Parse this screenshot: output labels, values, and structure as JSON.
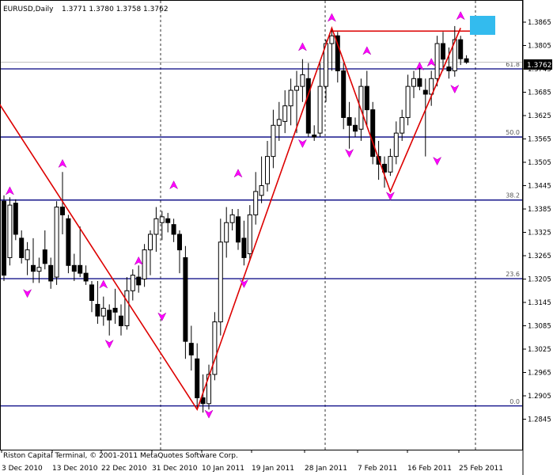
{
  "header": {
    "symbol": "EURUSD,Daily",
    "ohlc": "1.3771 1.3780 1.3758 1.3762"
  },
  "footer": {
    "copyright": "Riston Capital Terminal, © 2001-2011 MetaQuotes Software Corp."
  },
  "colors": {
    "background": "#ffffff",
    "axis": "#000000",
    "grid_vertical": "#000000",
    "fib_lines": "#000080",
    "zigzag": "#dd0000",
    "arrows": "#ff00ff",
    "highlight_box": "#33bbee",
    "price_tag_bg": "#000000",
    "price_tag_fg": "#ffffff"
  },
  "chart_data": {
    "type": "candlestick",
    "price_axis_labels": [
      "1.3865",
      "1.3805",
      "1.3745",
      "1.3685",
      "1.3625",
      "1.3565",
      "1.3505",
      "1.3445",
      "1.3385",
      "1.3325",
      "1.3265",
      "1.3205",
      "1.3145",
      "1.3085",
      "1.3025",
      "1.2965",
      "1.2905",
      "1.2845"
    ],
    "current_price": "1.3762",
    "date_labels": [
      "3 Dec 2010",
      "13 Dec 2010",
      "22 Dec 2010",
      "31 Dec 2010",
      "10 Jan 2011",
      "19 Jan 2011",
      "28 Jan 2011",
      "7 Feb 2011",
      "16 Feb 2011",
      "25 Feb 2011"
    ],
    "fibonacci_levels": [
      {
        "label": "61.8",
        "price": 1.3745
      },
      {
        "label": "50.0",
        "price": 1.357
      },
      {
        "label": "38.2",
        "price": 1.3408
      },
      {
        "label": "23.6",
        "price": 1.3206
      },
      {
        "label": "0.0",
        "price": 1.2879
      }
    ],
    "top_line_price": 1.3842,
    "ohlc_bars": [
      {
        "o": 1.3405,
        "h": 1.342,
        "l": 1.32,
        "c": 1.3215
      },
      {
        "o": 1.326,
        "h": 1.3415,
        "l": 1.324,
        "c": 1.3395
      },
      {
        "o": 1.34,
        "h": 1.341,
        "l": 1.3305,
        "c": 1.332
      },
      {
        "o": 1.331,
        "h": 1.333,
        "l": 1.3245,
        "c": 1.326
      },
      {
        "o": 1.3255,
        "h": 1.33,
        "l": 1.3215,
        "c": 1.328
      },
      {
        "o": 1.324,
        "h": 1.331,
        "l": 1.3195,
        "c": 1.3225
      },
      {
        "o": 1.3225,
        "h": 1.326,
        "l": 1.3195,
        "c": 1.3235
      },
      {
        "o": 1.328,
        "h": 1.333,
        "l": 1.323,
        "c": 1.3245
      },
      {
        "o": 1.324,
        "h": 1.326,
        "l": 1.318,
        "c": 1.32
      },
      {
        "o": 1.321,
        "h": 1.3405,
        "l": 1.319,
        "c": 1.339
      },
      {
        "o": 1.339,
        "h": 1.348,
        "l": 1.332,
        "c": 1.337
      },
      {
        "o": 1.336,
        "h": 1.337,
        "l": 1.322,
        "c": 1.324
      },
      {
        "o": 1.324,
        "h": 1.327,
        "l": 1.32,
        "c": 1.3225
      },
      {
        "o": 1.324,
        "h": 1.334,
        "l": 1.321,
        "c": 1.322
      },
      {
        "o": 1.322,
        "h": 1.324,
        "l": 1.319,
        "c": 1.32
      },
      {
        "o": 1.319,
        "h": 1.32,
        "l": 1.312,
        "c": 1.315
      },
      {
        "o": 1.314,
        "h": 1.32,
        "l": 1.309,
        "c": 1.311
      },
      {
        "o": 1.311,
        "h": 1.316,
        "l": 1.3085,
        "c": 1.313
      },
      {
        "o": 1.3125,
        "h": 1.314,
        "l": 1.306,
        "c": 1.31
      },
      {
        "o": 1.313,
        "h": 1.318,
        "l": 1.309,
        "c": 1.312
      },
      {
        "o": 1.311,
        "h": 1.314,
        "l": 1.306,
        "c": 1.3085
      },
      {
        "o": 1.3085,
        "h": 1.321,
        "l": 1.3075,
        "c": 1.3175
      },
      {
        "o": 1.3175,
        "h": 1.323,
        "l": 1.315,
        "c": 1.3215
      },
      {
        "o": 1.321,
        "h": 1.324,
        "l": 1.317,
        "c": 1.319
      },
      {
        "o": 1.3205,
        "h": 1.3295,
        "l": 1.3185,
        "c": 1.328
      },
      {
        "o": 1.328,
        "h": 1.333,
        "l": 1.3215,
        "c": 1.332
      },
      {
        "o": 1.332,
        "h": 1.339,
        "l": 1.3275,
        "c": 1.336
      },
      {
        "o": 1.335,
        "h": 1.338,
        "l": 1.3305,
        "c": 1.3365
      },
      {
        "o": 1.336,
        "h": 1.3375,
        "l": 1.3325,
        "c": 1.335
      },
      {
        "o": 1.3345,
        "h": 1.336,
        "l": 1.33,
        "c": 1.332
      },
      {
        "o": 1.332,
        "h": 1.333,
        "l": 1.322,
        "c": 1.328
      },
      {
        "o": 1.326,
        "h": 1.329,
        "l": 1.3,
        "c": 1.3045
      },
      {
        "o": 1.304,
        "h": 1.3085,
        "l": 1.297,
        "c": 1.301
      },
      {
        "o": 1.3,
        "h": 1.304,
        "l": 1.2875,
        "c": 1.29
      },
      {
        "o": 1.29,
        "h": 1.296,
        "l": 1.2862,
        "c": 1.2885
      },
      {
        "o": 1.2885,
        "h": 1.2985,
        "l": 1.287,
        "c": 1.296
      },
      {
        "o": 1.296,
        "h": 1.312,
        "l": 1.2945,
        "c": 1.3095
      },
      {
        "o": 1.3095,
        "h": 1.336,
        "l": 1.306,
        "c": 1.33
      },
      {
        "o": 1.33,
        "h": 1.339,
        "l": 1.326,
        "c": 1.335
      },
      {
        "o": 1.335,
        "h": 1.3385,
        "l": 1.333,
        "c": 1.337
      },
      {
        "o": 1.3365,
        "h": 1.3385,
        "l": 1.328,
        "c": 1.33
      },
      {
        "o": 1.331,
        "h": 1.3355,
        "l": 1.324,
        "c": 1.326
      },
      {
        "o": 1.327,
        "h": 1.3395,
        "l": 1.3255,
        "c": 1.337
      },
      {
        "o": 1.337,
        "h": 1.348,
        "l": 1.3345,
        "c": 1.343
      },
      {
        "o": 1.342,
        "h": 1.352,
        "l": 1.34,
        "c": 1.3445
      },
      {
        "o": 1.345,
        "h": 1.356,
        "l": 1.343,
        "c": 1.352
      },
      {
        "o": 1.352,
        "h": 1.364,
        "l": 1.349,
        "c": 1.36
      },
      {
        "o": 1.36,
        "h": 1.366,
        "l": 1.356,
        "c": 1.3615
      },
      {
        "o": 1.361,
        "h": 1.369,
        "l": 1.358,
        "c": 1.365
      },
      {
        "o": 1.365,
        "h": 1.372,
        "l": 1.36,
        "c": 1.369
      },
      {
        "o": 1.369,
        "h": 1.374,
        "l": 1.358,
        "c": 1.37
      },
      {
        "o": 1.37,
        "h": 1.377,
        "l": 1.366,
        "c": 1.373
      },
      {
        "o": 1.372,
        "h": 1.376,
        "l": 1.357,
        "c": 1.358
      },
      {
        "o": 1.3575,
        "h": 1.36,
        "l": 1.356,
        "c": 1.357
      },
      {
        "o": 1.358,
        "h": 1.376,
        "l": 1.357,
        "c": 1.37
      },
      {
        "o": 1.37,
        "h": 1.382,
        "l": 1.366,
        "c": 1.381
      },
      {
        "o": 1.381,
        "h": 1.3845,
        "l": 1.374,
        "c": 1.383
      },
      {
        "o": 1.383,
        "h": 1.384,
        "l": 1.371,
        "c": 1.374
      },
      {
        "o": 1.374,
        "h": 1.376,
        "l": 1.359,
        "c": 1.362
      },
      {
        "o": 1.362,
        "h": 1.366,
        "l": 1.354,
        "c": 1.36
      },
      {
        "o": 1.36,
        "h": 1.362,
        "l": 1.357,
        "c": 1.3585
      },
      {
        "o": 1.359,
        "h": 1.372,
        "l": 1.356,
        "c": 1.37
      },
      {
        "o": 1.37,
        "h": 1.374,
        "l": 1.36,
        "c": 1.364
      },
      {
        "o": 1.364,
        "h": 1.366,
        "l": 1.35,
        "c": 1.352
      },
      {
        "o": 1.352,
        "h": 1.356,
        "l": 1.346,
        "c": 1.35
      },
      {
        "o": 1.35,
        "h": 1.352,
        "l": 1.344,
        "c": 1.348
      },
      {
        "o": 1.348,
        "h": 1.354,
        "l": 1.347,
        "c": 1.352
      },
      {
        "o": 1.352,
        "h": 1.361,
        "l": 1.35,
        "c": 1.358
      },
      {
        "o": 1.358,
        "h": 1.364,
        "l": 1.356,
        "c": 1.362
      },
      {
        "o": 1.362,
        "h": 1.373,
        "l": 1.36,
        "c": 1.37
      },
      {
        "o": 1.37,
        "h": 1.374,
        "l": 1.367,
        "c": 1.372
      },
      {
        "o": 1.372,
        "h": 1.376,
        "l": 1.369,
        "c": 1.37
      },
      {
        "o": 1.369,
        "h": 1.372,
        "l": 1.352,
        "c": 1.368
      },
      {
        "o": 1.368,
        "h": 1.374,
        "l": 1.365,
        "c": 1.372
      },
      {
        "o": 1.372,
        "h": 1.383,
        "l": 1.37,
        "c": 1.381
      },
      {
        "o": 1.381,
        "h": 1.384,
        "l": 1.374,
        "c": 1.377
      },
      {
        "o": 1.375,
        "h": 1.38,
        "l": 1.372,
        "c": 1.374
      },
      {
        "o": 1.374,
        "h": 1.3855,
        "l": 1.3725,
        "c": 1.382
      },
      {
        "o": 1.382,
        "h": 1.383,
        "l": 1.3755,
        "c": 1.3771
      },
      {
        "o": 1.3771,
        "h": 1.378,
        "l": 1.3758,
        "c": 1.3762
      }
    ],
    "zigzag": [
      {
        "i": -1,
        "p": 1.366
      },
      {
        "i": 33,
        "p": 1.287
      },
      {
        "i": 56,
        "p": 1.385
      },
      {
        "i": 66,
        "p": 1.343
      },
      {
        "i": 78,
        "p": 1.385
      }
    ],
    "arrows_up": [
      {
        "i": 1,
        "p": 1.343
      },
      {
        "i": 10,
        "p": 1.35
      },
      {
        "i": 17,
        "p": 1.319
      },
      {
        "i": 23,
        "p": 1.325
      },
      {
        "i": 29,
        "p": 1.3445
      },
      {
        "i": 40,
        "p": 1.3475
      },
      {
        "i": 51,
        "p": 1.38
      },
      {
        "i": 56,
        "p": 1.3875
      },
      {
        "i": 62,
        "p": 1.379
      },
      {
        "i": 71,
        "p": 1.375
      },
      {
        "i": 73,
        "p": 1.376
      },
      {
        "i": 78,
        "p": 1.388
      }
    ],
    "arrows_down": [
      {
        "i": 4,
        "p": 1.317
      },
      {
        "i": 18,
        "p": 1.304
      },
      {
        "i": 27,
        "p": 1.311
      },
      {
        "i": 35,
        "p": 1.286
      },
      {
        "i": 41,
        "p": 1.3195
      },
      {
        "i": 51,
        "p": 1.3555
      },
      {
        "i": 59,
        "p": 1.353
      },
      {
        "i": 66,
        "p": 1.342
      },
      {
        "i": 74,
        "p": 1.351
      },
      {
        "i": 77,
        "p": 1.3695
      }
    ]
  }
}
